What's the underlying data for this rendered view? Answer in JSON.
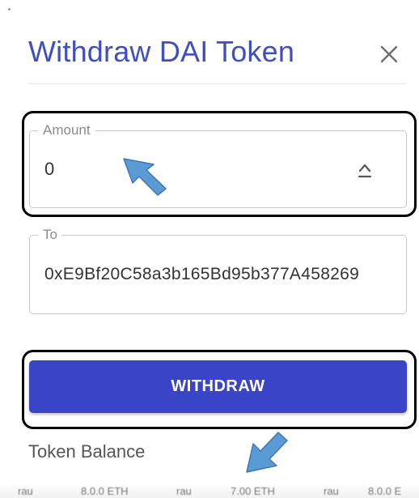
{
  "dialog": {
    "title": "Withdraw DAI Token",
    "close_icon": "close-icon",
    "accent_color": "#3944c6"
  },
  "amount_field": {
    "label": "Amount",
    "value": "0",
    "stepper_icon": "chevron-up-icon"
  },
  "to_field": {
    "label": "To",
    "value": "0xE9Bf20C58a3b165Bd95b377A458269"
  },
  "withdraw_button": {
    "label": "WITHDRAW"
  },
  "token_balance": {
    "label": "Token Balance"
  },
  "annotations": {
    "cursor_icon": "arrow-pointer-icon",
    "cursor_color": "#5b9bd5",
    "highlight_color": "#000000"
  },
  "underlay": {
    "fragments": [
      "rau",
      "8.0.0 ETH",
      "rau",
      "7.00 ETH",
      "rau",
      "8.0.0 E"
    ]
  }
}
